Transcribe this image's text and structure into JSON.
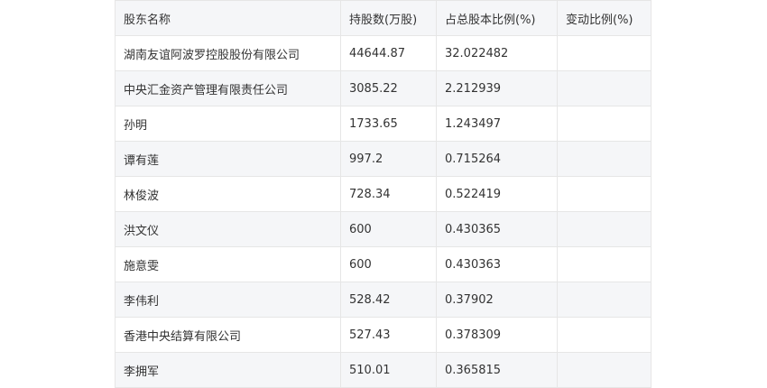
{
  "table": {
    "headers": [
      "股东名称",
      "持股数(万股)",
      "占总股本比例(%)",
      "变动比例(%)"
    ],
    "rows": [
      [
        "湖南友谊阿波罗控股股份有限公司",
        "44644.87",
        "32.022482",
        ""
      ],
      [
        "中央汇金资产管理有限责任公司",
        "3085.22",
        "2.212939",
        ""
      ],
      [
        "孙明",
        "1733.65",
        "1.243497",
        ""
      ],
      [
        "谭有莲",
        "997.2",
        "0.715264",
        ""
      ],
      [
        "林俊波",
        "728.34",
        "0.522419",
        ""
      ],
      [
        "洪文仪",
        "600",
        "0.430365",
        ""
      ],
      [
        "施意雯",
        "600",
        "0.430363",
        ""
      ],
      [
        "李伟利",
        "528.42",
        "0.37902",
        ""
      ],
      [
        "香港中央结算有限公司",
        "527.43",
        "0.378309",
        ""
      ],
      [
        "李拥军",
        "510.01",
        "0.365815",
        ""
      ]
    ]
  }
}
